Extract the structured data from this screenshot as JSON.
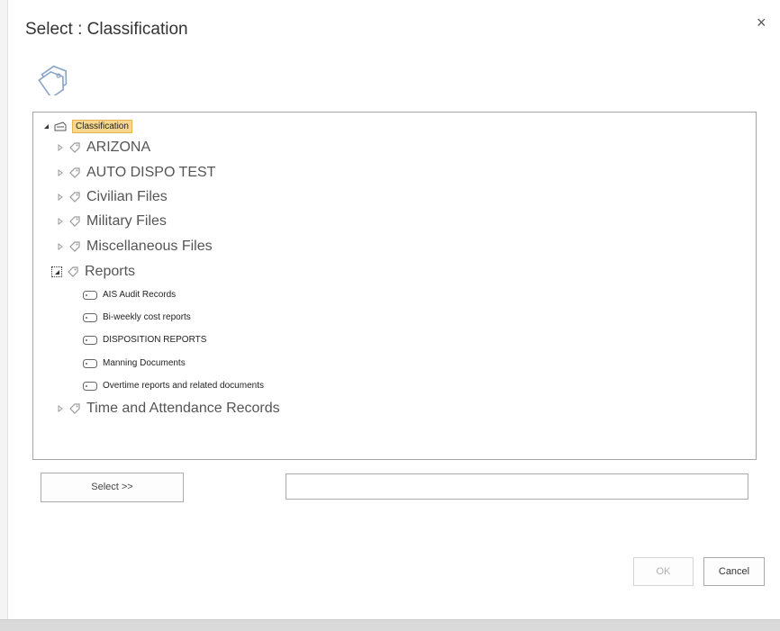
{
  "dialog": {
    "title": "Select : Classification",
    "close_glyph": "×"
  },
  "header_icon": "tags-icon",
  "tree": {
    "root_label": "Classification",
    "nodes": [
      {
        "label": "ARIZONA",
        "expanded": false
      },
      {
        "label": "AUTO DISPO TEST",
        "expanded": false
      },
      {
        "label": "Civilian Files",
        "expanded": false
      },
      {
        "label": "Military Files",
        "expanded": false
      },
      {
        "label": "Miscellaneous Files",
        "expanded": false
      },
      {
        "label": "Reports",
        "expanded": true,
        "children": [
          {
            "label": "AIS Audit Records"
          },
          {
            "label": "Bi-weekly cost reports"
          },
          {
            "label": "DISPOSITION REPORTS"
          },
          {
            "label": "Manning Documents"
          },
          {
            "label": "Overtime reports and related documents"
          }
        ]
      },
      {
        "label": "Time and Attendance Records",
        "expanded": false
      }
    ]
  },
  "select_row": {
    "select_button": "Select >>",
    "input_value": ""
  },
  "footer": {
    "ok_label": "OK",
    "cancel_label": "Cancel",
    "ok_enabled": false
  },
  "colors": {
    "selected_bg": "#f7d78d",
    "selected_border": "#e8b34e",
    "panel_border": "#a5a5a5"
  }
}
